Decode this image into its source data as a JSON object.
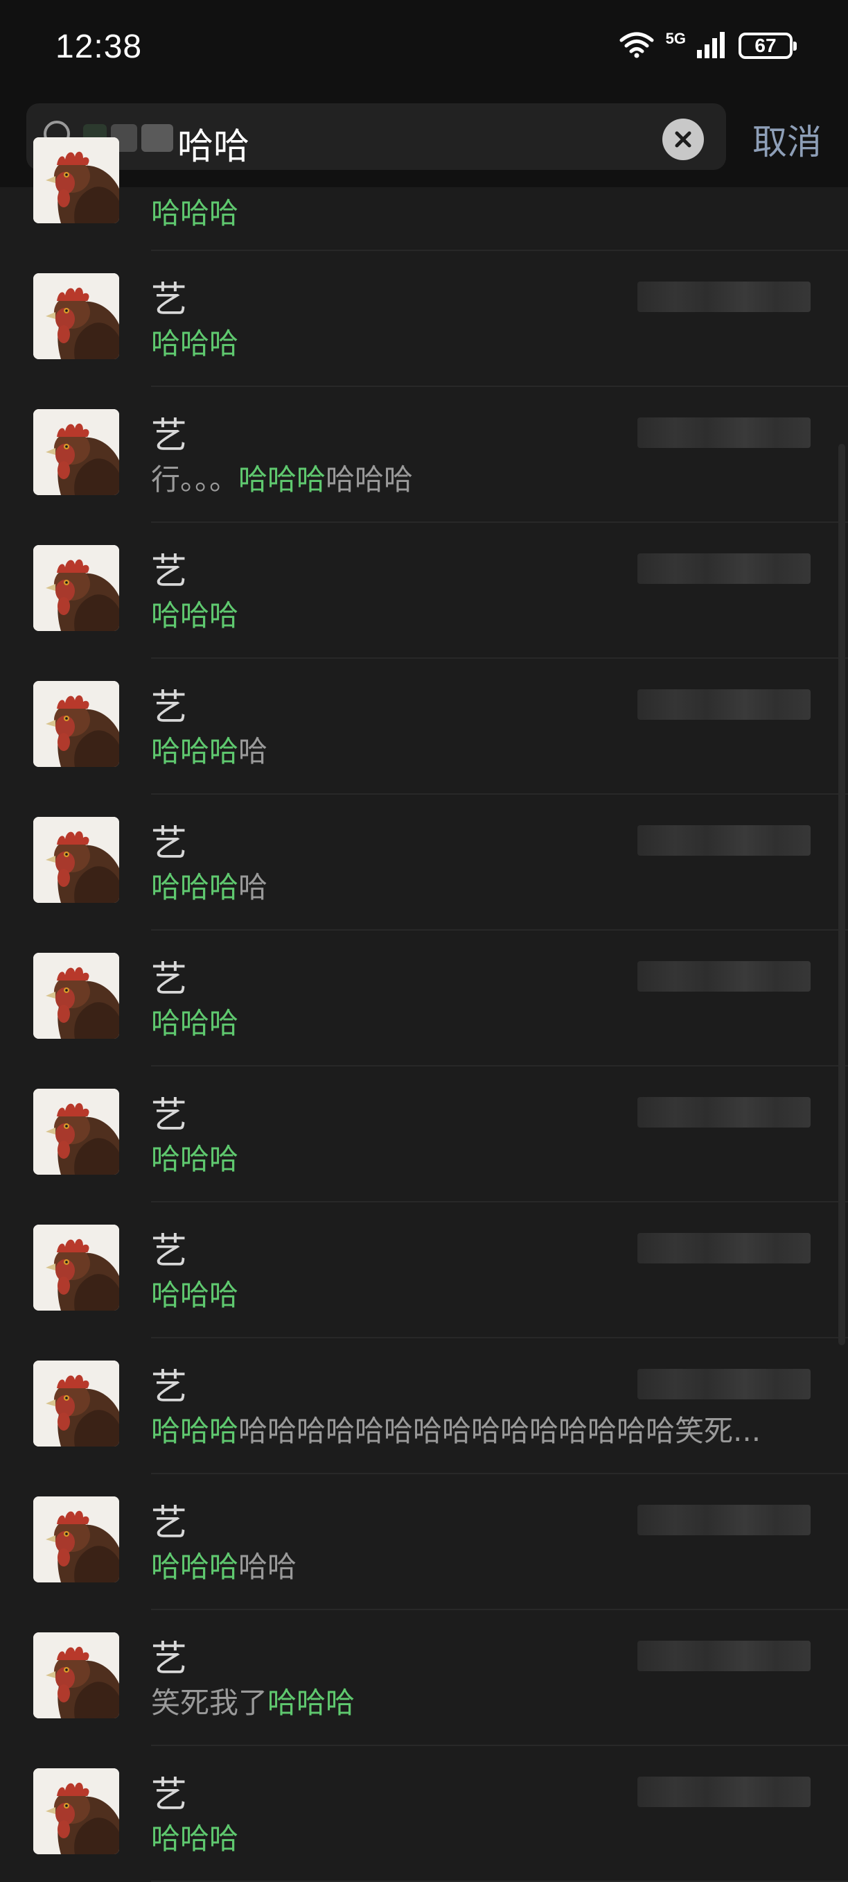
{
  "status_bar": {
    "time": "12:38",
    "network": "5G",
    "battery": "67",
    "icons": [
      "wifi-icon",
      "signal-icon",
      "battery-icon"
    ]
  },
  "search": {
    "query": "哈哈",
    "cancel_label": "取消",
    "icons": [
      "search-icon",
      "clear-icon"
    ]
  },
  "colors": {
    "background": "#1c1c1c",
    "header": "#111111",
    "highlight": "#5fc96f",
    "cancel": "#8e9fb8"
  },
  "results": [
    {
      "name": "",
      "snippet": [
        {
          "t": "哈哈哈",
          "h": true
        }
      ]
    },
    {
      "name": "艺",
      "snippet": [
        {
          "t": "哈哈哈",
          "h": true
        }
      ]
    },
    {
      "name": "艺",
      "snippet": [
        {
          "t": "行。。。",
          "h": false
        },
        {
          "t": "哈哈哈",
          "h": true
        },
        {
          "t": "哈哈哈",
          "h": false
        }
      ]
    },
    {
      "name": "艺",
      "snippet": [
        {
          "t": "哈哈哈",
          "h": true
        }
      ]
    },
    {
      "name": "艺",
      "snippet": [
        {
          "t": "哈哈哈",
          "h": true
        },
        {
          "t": "哈",
          "h": false
        }
      ]
    },
    {
      "name": "艺",
      "snippet": [
        {
          "t": "哈哈哈",
          "h": true
        },
        {
          "t": "哈",
          "h": false
        }
      ]
    },
    {
      "name": "艺",
      "snippet": [
        {
          "t": "哈哈哈",
          "h": true
        }
      ]
    },
    {
      "name": "艺",
      "snippet": [
        {
          "t": "哈哈哈",
          "h": true
        }
      ]
    },
    {
      "name": "艺",
      "snippet": [
        {
          "t": "哈哈哈",
          "h": true
        }
      ]
    },
    {
      "name": "艺",
      "snippet": [
        {
          "t": "哈哈哈",
          "h": true
        },
        {
          "t": "哈哈哈哈哈哈哈哈哈哈哈哈哈哈哈笑死...",
          "h": false
        }
      ]
    },
    {
      "name": "艺",
      "snippet": [
        {
          "t": "哈哈哈",
          "h": true
        },
        {
          "t": "哈哈",
          "h": false
        }
      ]
    },
    {
      "name": "艺",
      "snippet": [
        {
          "t": "笑死我了",
          "h": false
        },
        {
          "t": "哈哈哈",
          "h": true
        }
      ]
    },
    {
      "name": "艺",
      "snippet": [
        {
          "t": "哈哈哈",
          "h": true
        }
      ]
    }
  ]
}
